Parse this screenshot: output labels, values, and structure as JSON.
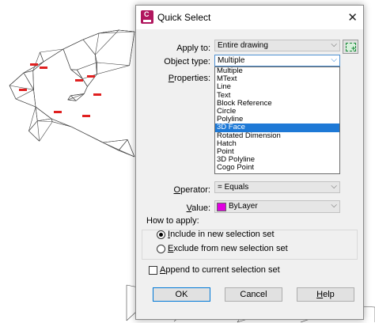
{
  "dialog": {
    "title": "Quick Select",
    "app_icon_letter": "C",
    "close_glyph": "✕"
  },
  "fields": {
    "apply_to": {
      "label_pre": "Apply to",
      "label_accel": "",
      "label_post": ":",
      "value": "Entire drawing"
    },
    "object_type": {
      "label": "Object type:",
      "value": "Multiple"
    },
    "properties": {
      "label_pre": "",
      "label_accel": "P",
      "label_post": "roperties:"
    },
    "operator": {
      "label_pre": "",
      "label_accel": "O",
      "label_post": "perator:",
      "value": "= Equals"
    },
    "value": {
      "label_pre": "",
      "label_accel": "V",
      "label_post": "alue:",
      "value": "ByLayer",
      "swatch_color": "#e000e0"
    }
  },
  "object_type_options": [
    "Multiple",
    "MText",
    "Line",
    "Text",
    "Block Reference",
    "Circle",
    "Polyline",
    "3D Face",
    "Rotated Dimension",
    "Hatch",
    "Point",
    "3D Polyline",
    "Cogo Point"
  ],
  "selected_option": "3D Face",
  "how_to_apply": {
    "title": "How to apply:",
    "include": {
      "accel": "I",
      "rest": "nclude in new selection set",
      "checked": true
    },
    "exclude": {
      "accel": "E",
      "rest": "xclude from new selection set",
      "checked": false
    }
  },
  "append": {
    "accel": "A",
    "rest": "ppend to current selection set",
    "checked": false
  },
  "buttons": {
    "ok": "OK",
    "cancel": "Cancel",
    "help_accel": "H",
    "help_rest": "elp"
  },
  "colors": {
    "selection_blue": "#1e79d6",
    "app_icon": "#b0165e",
    "tin_lines": "#444444",
    "label_red": "#e02020"
  },
  "icons": [
    "app-icon",
    "close-icon",
    "select-objects-icon",
    "dropdown-arrow-icon"
  ]
}
